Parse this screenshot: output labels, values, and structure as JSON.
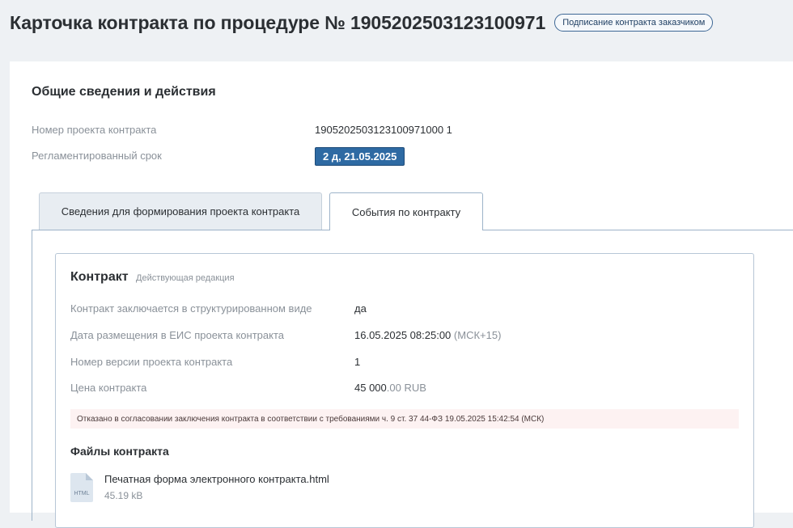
{
  "header": {
    "title": "Карточка контракта по процедуре № 1905202503123100971",
    "status_badge": "Подписание контракта заказчиком"
  },
  "general": {
    "section_title": "Общие сведения и действия",
    "project_number_label": "Номер проекта контракта",
    "project_number_value": "1905202503123100971000 1",
    "deadline_label": "Регламентированный срок",
    "deadline_value": "2 д, 21.05.2025"
  },
  "tabs": [
    {
      "label": "Сведения для формирования проекта контракта",
      "active": false
    },
    {
      "label": "События по контракту",
      "active": true
    }
  ],
  "contract": {
    "title": "Контракт",
    "edition": "Действующая редакция",
    "rows": [
      {
        "label": "Контракт заключается в структурированном виде",
        "value": "да"
      },
      {
        "label": "Дата размещения в ЕИС проекта контракта",
        "value": "16.05.2025 08:25:00",
        "suffix": "(МСК+15)"
      },
      {
        "label": "Номер версии проекта контракта",
        "value": "1"
      },
      {
        "label": "Цена контракта",
        "value": "45 000",
        "suffix": ".00 RUB"
      }
    ],
    "alert": "Отказано в согласовании заключения контракта в соответствии с требованиями ч. 9 ст. 37 44-ФЗ 19.05.2025 15:42:54 (МСК)",
    "files_title": "Файлы контракта",
    "files": [
      {
        "name": "Печатная форма электронного контракта.html",
        "size": "45.19 kB",
        "type": "HTML"
      }
    ]
  },
  "colors": {
    "accent": "#2e6aa3",
    "alert_bg": "#fdf2f2",
    "page_bg": "#eef1f4"
  }
}
